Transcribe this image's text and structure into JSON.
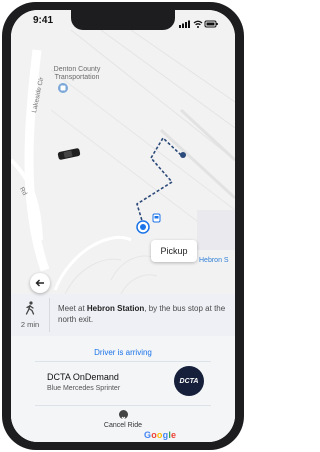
{
  "status_bar": {
    "time": "9:41"
  },
  "map": {
    "poi_label": "Denton County Transportation",
    "road_labels": {
      "lakeside": "Lakeside Cir",
      "rd": "Rd"
    },
    "pickup_callout": "Pickup",
    "station_label": "Hebron S",
    "colors": {
      "route": "#2c4a7a",
      "pickup_pin": "#1a73e8",
      "road": "#ffffff",
      "map_bg": "#f2f2f2"
    },
    "provider_logo": "Google"
  },
  "sheet": {
    "walk": {
      "minutes": "2 min",
      "text_before": "Meet at ",
      "station": "Hebron Station",
      "text_after": ", by the bus stop at the north exit."
    },
    "driver_status": "Driver is arriving",
    "ride": {
      "service_name": "DCTA OnDemand",
      "vehicle": "Blue Mercedes Sprinter",
      "logo_text": "DCTA"
    },
    "cancel_label": "Cancel Ride"
  },
  "icons": [
    "walk-icon",
    "back-arrow-icon",
    "cancel-icon",
    "car-icon",
    "transit-pin-icon",
    "bus-stop-icon"
  ]
}
